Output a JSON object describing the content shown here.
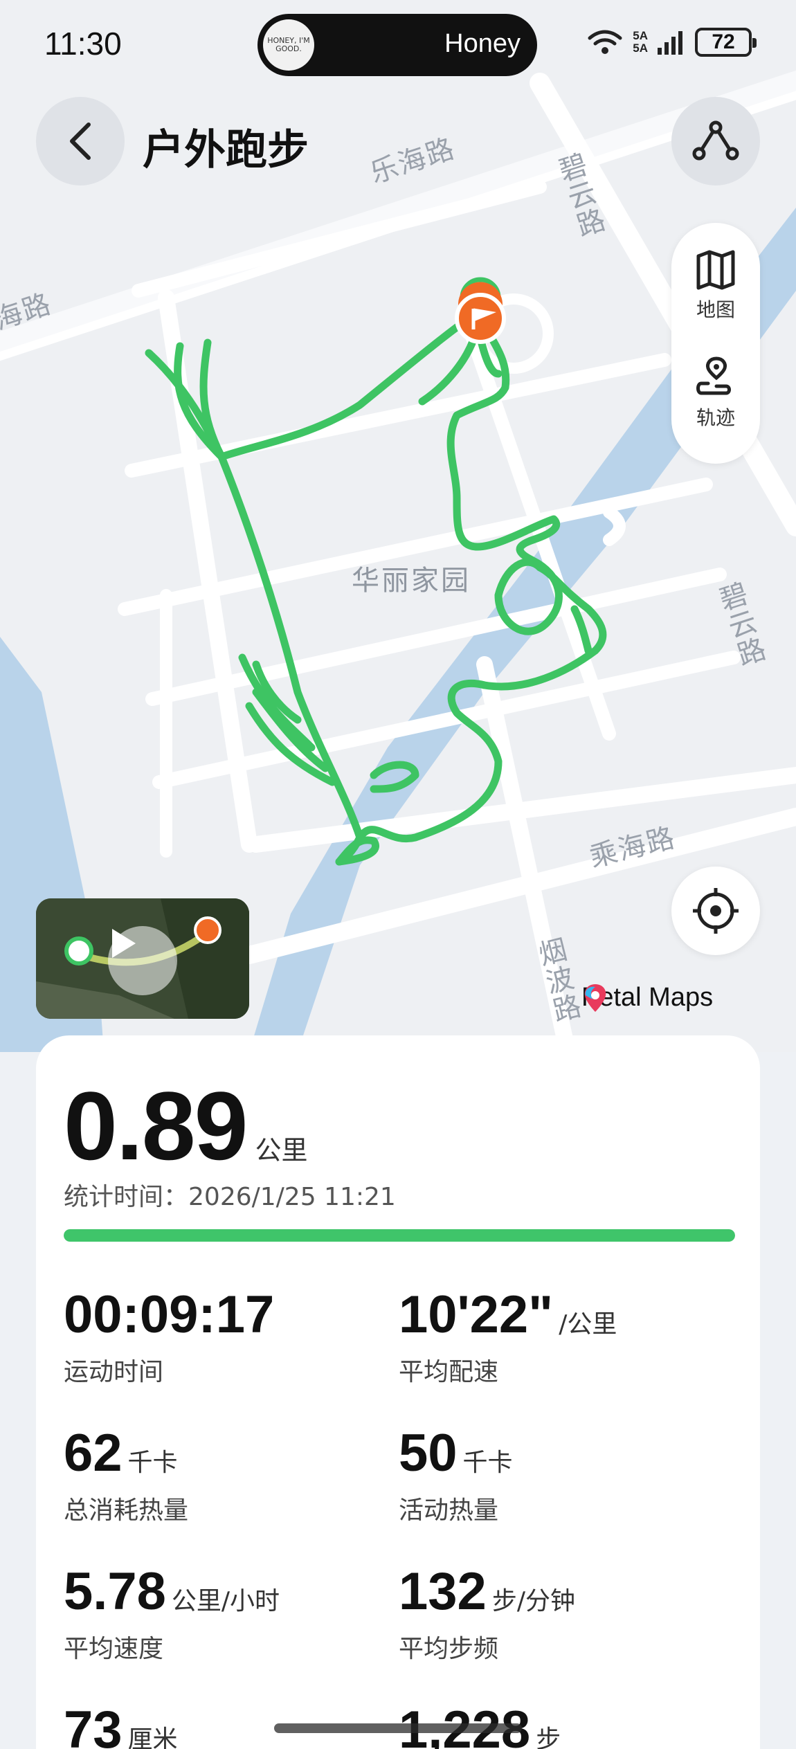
{
  "status_bar": {
    "time": "11:30",
    "now_playing_title": "Honey",
    "album_art_text": "HONEY, I'M GOOD.",
    "network_top": "5A",
    "network_bottom": "5A",
    "battery": "72"
  },
  "header": {
    "title": "户外跑步"
  },
  "map": {
    "roads": {
      "top": "乐海路",
      "top_left": "海路",
      "right_top": "碧云路",
      "right_mid": "碧云路",
      "bottom": "乘海路",
      "bottom_vert": "烟波路"
    },
    "area": "华丽家园",
    "route_color": "#3ec463",
    "start_color": "#3ec463",
    "end_color": "#f06a25",
    "attribution": "Petal Maps"
  },
  "layer_panel": {
    "map_label": "地图",
    "track_label": "轨迹"
  },
  "summary": {
    "distance": "0.89",
    "distance_unit": "公里",
    "stat_time_label": "统计时间：",
    "stat_time_value": "2026/1/25 11:21",
    "progress": 1.0,
    "progress_color": "#3fc56a"
  },
  "metrics": [
    {
      "value": "00:09:17",
      "unit": "",
      "label": "运动时间"
    },
    {
      "value": "10'22\"",
      "unit": "/公里",
      "label": "平均配速"
    },
    {
      "value": "62",
      "unit": "千卡",
      "label": "总消耗热量"
    },
    {
      "value": "50",
      "unit": "千卡",
      "label": "活动热量"
    },
    {
      "value": "5.78",
      "unit": "公里/小时",
      "label": "平均速度"
    },
    {
      "value": "132",
      "unit": "步/分钟",
      "label": "平均步频"
    },
    {
      "value": "73",
      "unit": "厘米",
      "label": ""
    },
    {
      "value": "1,228",
      "unit": "步",
      "label": ""
    }
  ]
}
